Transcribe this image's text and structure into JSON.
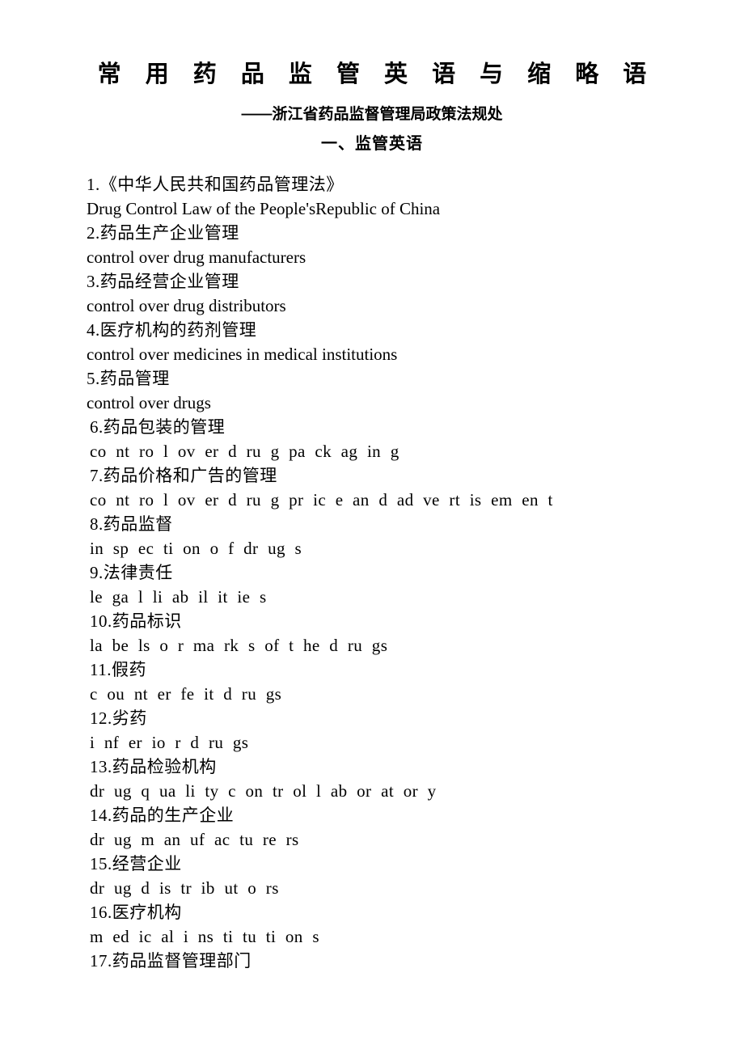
{
  "header": {
    "title": "常 用 药 品 监 管 英 语 与 缩 略 语",
    "subtitle": "——浙江省药品监督管理局政策法规处",
    "section_heading": "一、监管英语"
  },
  "entries": [
    {
      "zh": "1.《中华人民共和国药品管理法》",
      "en": "Drug Control Law of the People'sRepublic of China",
      "fragmented": false,
      "indented": false
    },
    {
      "zh": "2.药品生产企业管理",
      "en": "control over drug manufacturers",
      "fragmented": false,
      "indented": false
    },
    {
      "zh": "3.药品经营企业管理",
      "en": "control over drug distributors",
      "fragmented": false,
      "indented": false
    },
    {
      "zh": "4.医疗机构的药剂管理",
      "en": "control over medicines in medical institutions",
      "fragmented": false,
      "indented": false
    },
    {
      "zh": "5.药品管理",
      "en": "control over drugs",
      "fragmented": false,
      "indented": false
    },
    {
      "zh": "6.药品包装的管理",
      "en": "co nt ro l  ov er  d ru g  pa ck ag in g",
      "fragmented": true,
      "indented": true
    },
    {
      "zh": "7.药品价格和广告的管理",
      "en": "co nt ro l  ov er  d ru g  pr ic e  an d  ad ve rt is em en t",
      "fragmented": true,
      "indented": true
    },
    {
      "zh": "8.药品监督",
      "en": "in sp ec ti on  o f  dr ug s",
      "fragmented": true,
      "indented": true
    },
    {
      "zh": "9.法律责任",
      "en": "le ga l  li ab il it ie s",
      "fragmented": true,
      "indented": true
    },
    {
      "zh": "10.药品标识",
      "en": "la be ls  o r  ma rk s  of  t he  d ru gs",
      "fragmented": true,
      "indented": true
    },
    {
      "zh": "11.假药",
      "en": "c ou nt er fe it d ru gs",
      "fragmented": true,
      "indented": true
    },
    {
      "zh": "12.劣药",
      "en": "i nf er io r  d ru gs",
      "fragmented": true,
      "indented": true
    },
    {
      "zh": "13.药品检验机构",
      "en": "dr ug  q ua li ty  c on tr ol  l ab or at or y",
      "fragmented": true,
      "indented": true
    },
    {
      "zh": "14.药品的生产企业",
      "en": "dr ug  m an uf ac tu re rs",
      "fragmented": true,
      "indented": true
    },
    {
      "zh": "15.经营企业",
      "en": "dr ug  d is tr ib ut o rs",
      "fragmented": true,
      "indented": true
    },
    {
      "zh": "16.医疗机构",
      "en": "m ed ic al i ns ti tu ti on s",
      "fragmented": true,
      "indented": true
    },
    {
      "zh": "17.药品监督管理部门",
      "en": null,
      "fragmented": true,
      "indented": true
    }
  ]
}
